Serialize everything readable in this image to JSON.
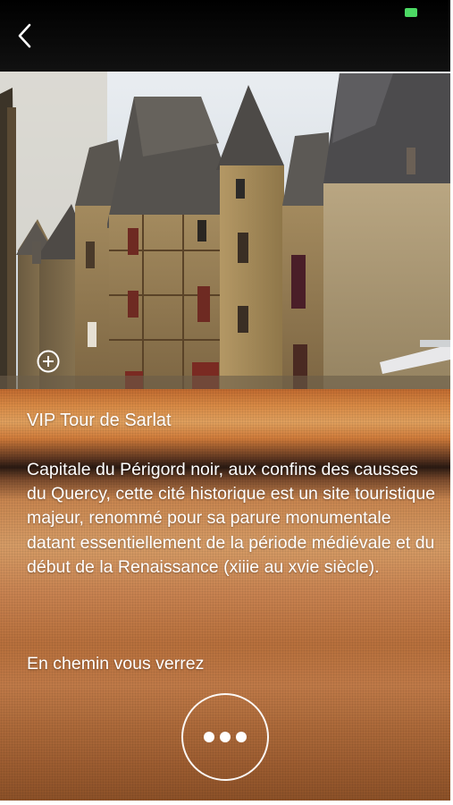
{
  "colors": {
    "battery": "#4cd964",
    "text": "#ffffff",
    "panel_accent": "#d08a4a"
  },
  "icons": {
    "back": "chevron-left-icon",
    "battery": "battery-icon",
    "zoom": "plus-circle-icon",
    "more": "ellipsis-icon"
  },
  "tour": {
    "title": "VIP Tour de Sarlat",
    "description": "Capitale du Périgord noir, aux confins des causses du Quercy, cette cité historique est un site touristique majeur, renommé pour sa parure monumentale datant essentiellement de la période médiévale et du début de la Renaissance (xiiie au xvie siècle).",
    "subheading": "En chemin vous verrez"
  }
}
